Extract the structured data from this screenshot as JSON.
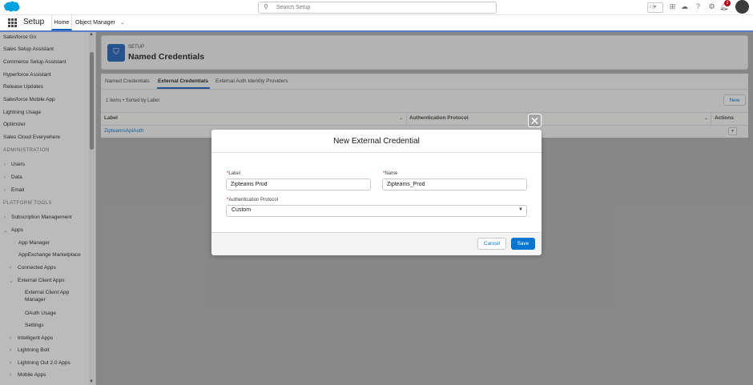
{
  "header": {
    "search_placeholder": "Search Setup",
    "notification_count": "2",
    "favorites_label": "☆|▾"
  },
  "nav": {
    "app_name": "Setup",
    "tab_home": "Home",
    "tab_object_manager": "Object Manager"
  },
  "sidebar": {
    "items_top": [
      "Salesforce Go",
      "Sales Setup Assistant",
      "Commerce Setup Assistant",
      "Hyperforce Assistant",
      "Release Updates",
      "Salesforce Mobile App",
      "Lightning Usage",
      "Optimizer",
      "Sales Cloud Everywhere"
    ],
    "section_admin": "ADMINISTRATION",
    "admin_items": [
      "Users",
      "Data",
      "Email"
    ],
    "section_platform": "PLATFORM TOOLS",
    "platform_items": [
      "Subscription Management",
      "Apps"
    ],
    "apps_children": [
      "App Manager",
      "AppExchange Marketplace"
    ],
    "connected_apps": "Connected Apps",
    "external_client_apps": "External Client Apps",
    "eca_children": [
      "External Client App",
      "Manager",
      "OAuth Usage",
      "Settings"
    ],
    "more_items": [
      "Intelligent Apps",
      "Lightning Bolt",
      "Lightning Out 2.0 Apps",
      "Mobile Apps"
    ]
  },
  "page": {
    "kicker": "SETUP",
    "title": "Named Credentials",
    "tabs": [
      "Named Credentials",
      "External Credentials",
      "External Auth Identity Providers"
    ],
    "list_meta": "1 items • Sorted by Label",
    "new_button": "New",
    "columns": [
      "Label",
      "Authentication Protocol",
      "Actions"
    ],
    "rows": [
      {
        "label": "ZipteamsApiAuth"
      }
    ]
  },
  "modal": {
    "title": "New External Credential",
    "label_field_label": "Label",
    "label_field_value": "Zipteams Prod",
    "name_field_label": "Name",
    "name_field_value": "Zipteams_Prod",
    "auth_protocol_label": "Authentication Protocol",
    "auth_protocol_value": "Custom",
    "required_mark": "*",
    "cancel_label": "Cancel",
    "save_label": "Save"
  },
  "colors": {
    "brand_blue": "#0176d3",
    "nav_underline": "#5a7bc7",
    "required_red": "#ba0517"
  }
}
